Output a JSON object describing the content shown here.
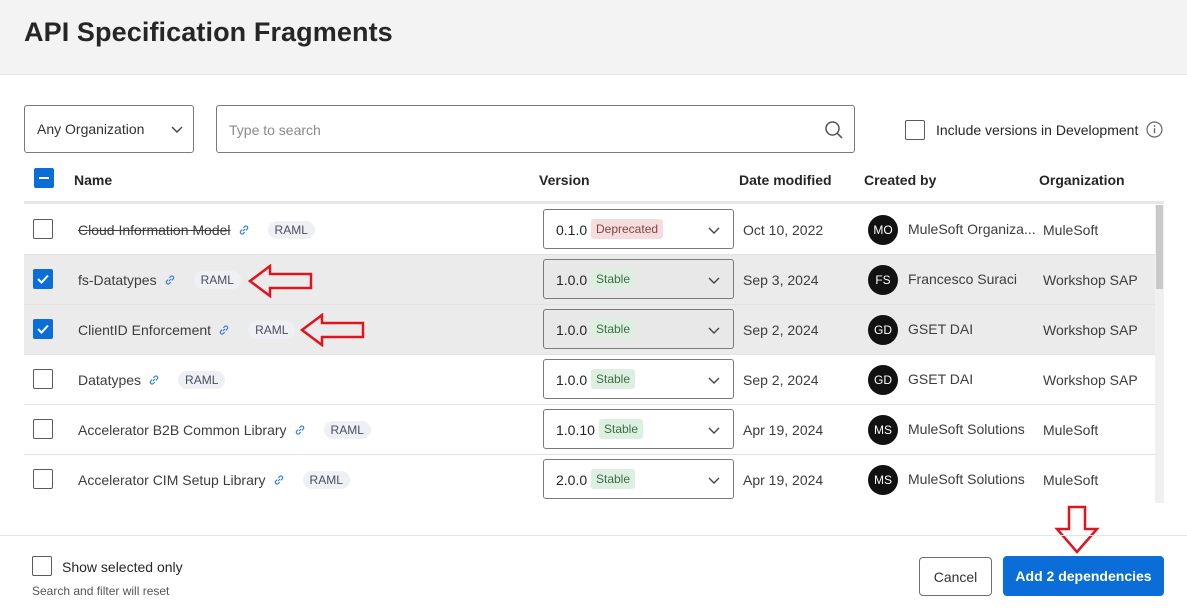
{
  "dialog": {
    "title": "API Specification Fragments"
  },
  "filters": {
    "organization": "Any Organization",
    "search_placeholder": "Type to search",
    "include_dev_label": "Include versions in Development",
    "include_dev_checked": false
  },
  "table": {
    "columns": {
      "name": "Name",
      "version": "Version",
      "date": "Date modified",
      "created_by": "Created by",
      "organization": "Organization"
    },
    "rows": [
      {
        "name": "Cloud Information Model",
        "type": "RAML",
        "version": "0.1.0",
        "status": "Deprecated",
        "date": "Oct 10, 2022",
        "initials": "MO",
        "creator": "MuleSoft Organiza...",
        "organization": "MuleSoft",
        "selected": false
      },
      {
        "name": "fs-Datatypes",
        "type": "RAML",
        "version": "1.0.0",
        "status": "Stable",
        "date": "Sep 3, 2024",
        "initials": "FS",
        "creator": "Francesco Suraci",
        "organization": "Workshop SAP",
        "selected": true
      },
      {
        "name": "ClientID Enforcement",
        "type": "RAML",
        "version": "1.0.0",
        "status": "Stable",
        "date": "Sep 2, 2024",
        "initials": "GD",
        "creator": "GSET DAI",
        "organization": "Workshop SAP",
        "selected": true
      },
      {
        "name": "Datatypes",
        "type": "RAML",
        "version": "1.0.0",
        "status": "Stable",
        "date": "Sep 2, 2024",
        "initials": "GD",
        "creator": "GSET DAI",
        "organization": "Workshop SAP",
        "selected": false
      },
      {
        "name": "Accelerator B2B Common Library",
        "type": "RAML",
        "version": "1.0.10",
        "status": "Stable",
        "date": "Apr 19, 2024",
        "initials": "MS",
        "creator": "MuleSoft Solutions",
        "organization": "MuleSoft",
        "selected": false
      },
      {
        "name": "Accelerator CIM Setup Library",
        "type": "RAML",
        "version": "2.0.0",
        "status": "Stable",
        "date": "Apr 19, 2024",
        "initials": "MS",
        "creator": "MuleSoft Solutions",
        "organization": "MuleSoft",
        "selected": false
      }
    ]
  },
  "footer": {
    "show_selected_label": "Show selected only",
    "hint": "Search and filter will reset",
    "cancel_label": "Cancel",
    "add_label": "Add 2 dependencies"
  },
  "colors": {
    "accent": "#0b6ed8",
    "annotation_arrow": "#e0141e",
    "stable_bg": "#dcefe0",
    "deprecated_bg": "#f6dcdc"
  },
  "icons": [
    "chevron-down-icon",
    "search-icon",
    "info-icon",
    "link-icon",
    "check-icon",
    "indeterminate-icon",
    "arrow-left-annotation",
    "arrow-down-annotation"
  ]
}
